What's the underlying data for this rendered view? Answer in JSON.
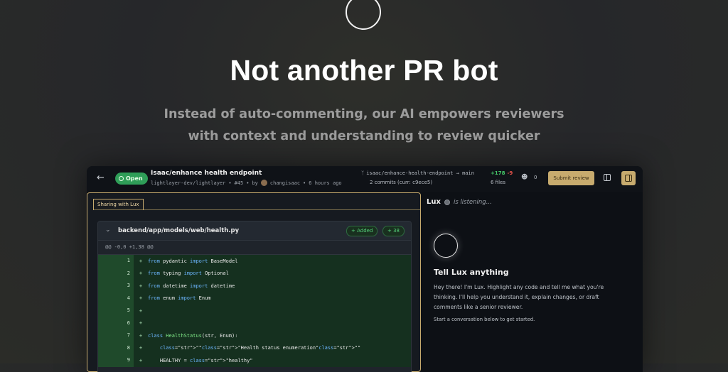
{
  "hero": {
    "title": "Not another PR bot",
    "subtitle_line1": "Instead of auto-commenting, our AI empowers reviewers",
    "subtitle_line2": "with context and understanding to review quicker"
  },
  "topbar": {
    "status": "Open",
    "pr_title": "Isaac/enhance health endpoint",
    "repo": "lightlayer-dev/lightlayer",
    "pr_number": "#45",
    "by": "by",
    "author": "changisaac",
    "time": "6 hours ago",
    "branch": "isaac/enhance-health-endpoint",
    "target_branch": "main",
    "commits": "2 commits (curr: c9ece5)",
    "additions": "+178",
    "deletions": "-9",
    "files": "6 files",
    "reviewer_count": "0",
    "submit_label": "Submit review"
  },
  "left_pane": {
    "tab_label": "Sharing with Lux",
    "file": {
      "path": "backend/app/models/web/health.py",
      "added_badge": "+ Added",
      "count_badge": "+ 38",
      "hunk": "@@ -0,0 +1,38 @@"
    },
    "lines": [
      {
        "n": "1",
        "code": "from pydantic import BaseModel"
      },
      {
        "n": "2",
        "code": "from typing import Optional"
      },
      {
        "n": "3",
        "code": "from datetime import datetime"
      },
      {
        "n": "4",
        "code": "from enum import Enum"
      },
      {
        "n": "5",
        "code": ""
      },
      {
        "n": "6",
        "code": ""
      },
      {
        "n": "7",
        "code": "class HealthStatus(str, Enum):"
      },
      {
        "n": "8",
        "code": "    \"\"\"Health status enumeration\"\"\""
      },
      {
        "n": "9",
        "code": "    HEALTHY = \"healthy\""
      }
    ]
  },
  "right_pane": {
    "name": "Lux",
    "status": "is listening...",
    "heading": "Tell Lux anything",
    "body": "Hey there! I'm Lux. Highlight any code and tell me what you're thinking. I'll help you understand it, explain changes, or draft comments like a senior reviewer.",
    "hint": "Start a conversation below to get started."
  },
  "colors": {
    "accent": "#c7ab6e",
    "open_green": "#2f9e58",
    "addition_green": "#44c768",
    "deletion_red": "#e5534b"
  }
}
